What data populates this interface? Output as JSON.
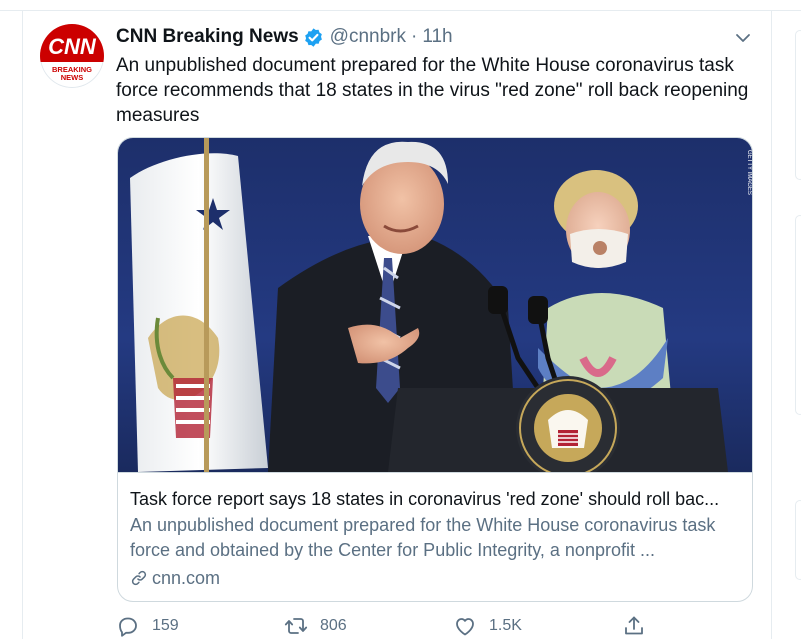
{
  "tweet": {
    "display_name": "CNN Breaking News",
    "handle": "@cnnbrk",
    "separator": "·",
    "timestamp": "11h",
    "text": "An unpublished document prepared for the White House coronavirus task force recommends that 18 states in the virus \"red zone\" roll back reopening measures",
    "avatar": {
      "logo_text": "CNN",
      "sub_line1": "BREAKING",
      "sub_line2": "NEWS",
      "brand_color": "#cc0000"
    },
    "verified_color": "#1da1f2"
  },
  "card": {
    "title": "Task force report says 18 states in coronavirus 'red zone' should roll bac...",
    "description": "An unpublished document prepared for the White House coronavirus task force and obtained by the Center for Public Integrity, a nonprofit ...",
    "domain": "cnn.com",
    "image_credit": "GETTY IMAGES",
    "seal_text": "PRESIDENT OF THE UNITED STATES"
  },
  "actions": {
    "reply_count": "159",
    "retweet_count": "806",
    "like_count": "1.5K"
  },
  "colors": {
    "text_primary": "#0f1419",
    "text_secondary": "#5b7083",
    "border": "#cfd9de",
    "accent": "#1da1f2"
  },
  "icons": [
    "cnn-avatar",
    "verified-badge-icon",
    "chevron-down-icon",
    "link-icon",
    "reply-icon",
    "retweet-icon",
    "like-icon",
    "share-icon"
  ]
}
